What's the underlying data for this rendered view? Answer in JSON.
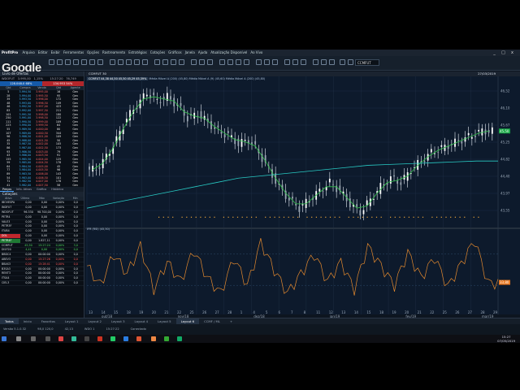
{
  "app": {
    "brand": "ProfitPro",
    "menu": [
      "Arquivo",
      "Editar",
      "Exibir",
      "Ferramentas",
      "Opções",
      "Rastreamento",
      "Estratégias",
      "Cotações",
      "Gráficos",
      "Janela",
      "Ajuda",
      "Atualização Disponível",
      "Ao Vivo"
    ],
    "symbol_box": "CCMFUT",
    "window_controls": [
      "_",
      "□",
      "x"
    ]
  },
  "google_overlay": "Google",
  "book": {
    "title": "Livro de Ofertas",
    "quote": [
      "WDOFUT",
      "3.995,00",
      "1,15%",
      "15:27:20",
      "76,749"
    ],
    "headers": [
      "Qtd",
      "Compra",
      "Venda",
      "Qtd",
      "Agente"
    ],
    "totals": [
      "128.048.0 68%",
      "134.953 54%"
    ],
    "rows": [
      [
        "5",
        "3.994,50",
        "3.995,00",
        "16",
        "Gen"
      ],
      [
        "28",
        "3.994,00",
        "3.995,50",
        "95",
        "Gen"
      ],
      [
        "39",
        "3.993,50",
        "3.996,00",
        "172",
        "Gen"
      ],
      [
        "48",
        "3.993,00",
        "3.996,50",
        "149",
        "Gen"
      ],
      [
        "46",
        "3.992,50",
        "3.997,00",
        "423",
        "Gen"
      ],
      [
        "83",
        "3.992,00",
        "3.997,50",
        "211",
        "Gen"
      ],
      [
        "101",
        "3.991,50",
        "3.998,00",
        "180",
        "Gen"
      ],
      [
        "250",
        "3.991,00",
        "3.998,50",
        "122",
        "Gen"
      ],
      [
        "111",
        "3.990,50",
        "3.999,00",
        "109",
        "Gen"
      ],
      [
        "223",
        "3.990,00",
        "3.999,50",
        "64",
        "Gen"
      ],
      [
        "55",
        "3.989,50",
        "4.000,00",
        "80",
        "Gen"
      ],
      [
        "107",
        "3.989,00",
        "4.000,50",
        "344",
        "Gen"
      ],
      [
        "96",
        "3.988,50",
        "4.001,00",
        "109",
        "Gen"
      ],
      [
        "45",
        "3.988,00",
        "4.001,50",
        "50",
        "Gen"
      ],
      [
        "35",
        "3.987,50",
        "4.002,00",
        "105",
        "Gen"
      ],
      [
        "86",
        "3.987,00",
        "4.002,50",
        "173",
        "Gen"
      ],
      [
        "93",
        "3.986,50",
        "4.003,00",
        "79",
        "Gen"
      ],
      [
        "43",
        "3.986,00",
        "4.003,50",
        "91",
        "Gen"
      ],
      [
        "155",
        "3.985,50",
        "4.004,00",
        "125",
        "Gen"
      ],
      [
        "59",
        "3.985,00",
        "4.004,50",
        "178",
        "Gen"
      ],
      [
        "64",
        "3.984,50",
        "4.005,00",
        "45",
        "Gen"
      ],
      [
        "77",
        "3.984,00",
        "4.005,50",
        "96",
        "Gen"
      ],
      [
        "89",
        "3.983,50",
        "4.006,00",
        "143",
        "Gen"
      ],
      [
        "54",
        "3.983,00",
        "4.006,50",
        "101",
        "Gen"
      ],
      [
        "71",
        "3.982,50",
        "4.007,00",
        "178",
        "Gen"
      ],
      [
        "41",
        "3.982,00",
        "4.007,50",
        "58",
        "Gen"
      ]
    ],
    "tabs": [
      "Preços",
      "Info. Ativos",
      "Gráfico",
      "Histórico"
    ]
  },
  "watchlist": {
    "title": "Cotações",
    "headers": [
      "Ativo",
      "Último",
      "Máx",
      "Variação",
      "Mín"
    ],
    "rows": [
      {
        "sym": "IBOVESPA",
        "v": [
          "0,00",
          "0,00",
          "0,00%",
          "0,0"
        ],
        "cls": ""
      },
      {
        "sym": "INDFUT",
        "v": [
          "0,00",
          "0,00",
          "0,00%",
          "0,0"
        ],
        "cls": ""
      },
      {
        "sym": "WDOFUT",
        "v": [
          "96.330",
          "98.700,00",
          "0,00%",
          "0,0"
        ],
        "cls": ""
      },
      {
        "sym": "PETR4",
        "v": [
          "0,00",
          "0,00",
          "0,00%",
          "0,0"
        ],
        "cls": ""
      },
      {
        "sym": "VALE3",
        "v": [
          "0,00",
          "0,00",
          "0,00%",
          "0,0"
        ],
        "cls": ""
      },
      {
        "sym": "PETR3F",
        "v": [
          "0,00",
          "0,00",
          "0,00%",
          "0,0"
        ],
        "cls": ""
      },
      {
        "sym": "ITUB4",
        "v": [
          "0,00",
          "0,00",
          "0,00%",
          "0,0"
        ],
        "cls": ""
      },
      {
        "sym": "DOL",
        "v": [
          "0,00",
          "0,00",
          "0,00%",
          "0,0"
        ],
        "cls": "hl"
      },
      {
        "sym": "PETR4F",
        "v": [
          "0,00",
          "1.827,11",
          "0,00%",
          "0,0"
        ],
        "cls": "hl2"
      },
      {
        "sym": "CCMFUT",
        "v": [
          "45,50",
          "15:27:24",
          "0,00%",
          "3,0"
        ],
        "cls": "up"
      },
      {
        "sym": "DI1F20",
        "v": [
          "4,41",
          "0,00",
          "0,00%",
          "0,0"
        ],
        "cls": "up"
      },
      {
        "sym": "BBDC4",
        "v": [
          "0,00",
          "00:00:00",
          "0,00%",
          "0,0"
        ],
        "cls": ""
      },
      {
        "sym": "ABEV3",
        "v": [
          "0,00",
          "15:27:26",
          "0,00%",
          "0,0"
        ],
        "cls": "dn"
      },
      {
        "sym": "BBAS3",
        "v": [
          "0,00",
          "15:28:41",
          "0,00%",
          "0,0"
        ],
        "cls": "dn"
      },
      {
        "sym": "B3SA3",
        "v": [
          "0,00",
          "00:00:00",
          "0,00%",
          "0,0"
        ],
        "cls": ""
      },
      {
        "sym": "RENT3",
        "v": [
          "0,00",
          "00:00:00",
          "0,00%",
          "0,0"
        ],
        "cls": ""
      },
      {
        "sym": "ITSA4",
        "v": [
          "0,00",
          "00:00:00",
          "0,00%",
          "0,0"
        ],
        "cls": ""
      },
      {
        "sym": "CIEL3",
        "v": [
          "0,00",
          "00:00:00",
          "0,00%",
          "0,0"
        ],
        "cls": ""
      }
    ]
  },
  "chart": {
    "tab_title": "CCMFUT 30",
    "date": "27/03/2019",
    "info": "CCMFUT 44,38 44,50 45,50 45,29 45,39%",
    "indicators": [
      "Média Móvel A (200) (45,80)",
      "Média Móvel A (9) (45,60)",
      "Média Móvel A (200) (45,80)"
    ],
    "last_price_tag": "45,50",
    "y_ticks": [
      "46,52",
      "46,10",
      "45,67",
      "45,25",
      "44,82",
      "44,40",
      "43,97",
      "43,55"
    ],
    "osc_title": "IFR (RSI) (45,50)",
    "osc_tag": "33,80",
    "x_ticks": [
      "13",
      "14",
      "15",
      "18",
      "19",
      "20",
      "21",
      "22",
      "25",
      "26",
      "27",
      "28",
      "1",
      "4",
      "5",
      "6",
      "7",
      "8",
      "11",
      "12",
      "13",
      "14",
      "15",
      "18",
      "19",
      "20",
      "21",
      "22",
      "25",
      "26",
      "27",
      "28",
      "29"
    ],
    "month_labels": [
      "out/18",
      "nov/18",
      "dez/18",
      "jan/19",
      "fev/19",
      "mar/19"
    ]
  },
  "chart_data": {
    "type": "line",
    "title": "",
    "series": [
      {
        "name": "CCMFUT",
        "values": [
          44.6,
          44.9,
          45.3,
          45.8,
          46.1,
          46.4,
          46.2,
          46.3,
          46.1,
          45.8,
          45.9,
          45.7,
          45.5,
          45.4,
          45.2,
          45.3,
          45.0,
          44.6,
          44.2,
          43.9,
          43.7,
          43.9,
          44.1,
          44.3,
          44.1,
          43.8,
          43.6,
          43.9,
          44.2,
          44.4,
          44.3,
          44.6,
          44.8,
          45.0,
          45.1,
          45.2,
          45.3,
          45.4,
          45.5,
          45.5
        ]
      },
      {
        "name": "Média Móvel A (200)",
        "values": [
          43.7,
          43.8,
          43.9,
          44.0,
          44.1,
          44.2,
          44.3,
          44.4,
          44.45,
          44.5,
          44.55,
          44.6,
          44.65,
          44.7,
          44.72,
          44.74,
          44.76,
          44.78,
          44.8,
          44.8
        ]
      },
      {
        "name": "IFR (RSI)",
        "values": [
          55,
          30,
          70,
          45,
          80,
          25,
          60,
          35,
          75,
          40,
          20,
          65,
          30,
          85,
          50,
          20,
          45,
          70,
          35,
          60,
          25,
          80,
          55,
          30,
          72,
          40,
          66,
          28,
          58,
          88,
          33
        ]
      }
    ],
    "ylim": [
      43.4,
      46.7
    ],
    "grid": true,
    "legend": "top-left"
  },
  "bottom_tabs": [
    "Todos",
    "Inicio",
    "Favoritos",
    "Layout 1",
    "Layout 2",
    "Layout 3",
    "Layout 4",
    "Layout 5",
    "Layout 6",
    "CCMF / ML",
    "+"
  ],
  "status": [
    "Versão 5.1.0.32",
    "98,0 120,0",
    "42,13",
    "WDO 1",
    "15:27:22",
    "Conectado"
  ],
  "clock": {
    "time": "15:27",
    "date": "07/05/2019"
  }
}
